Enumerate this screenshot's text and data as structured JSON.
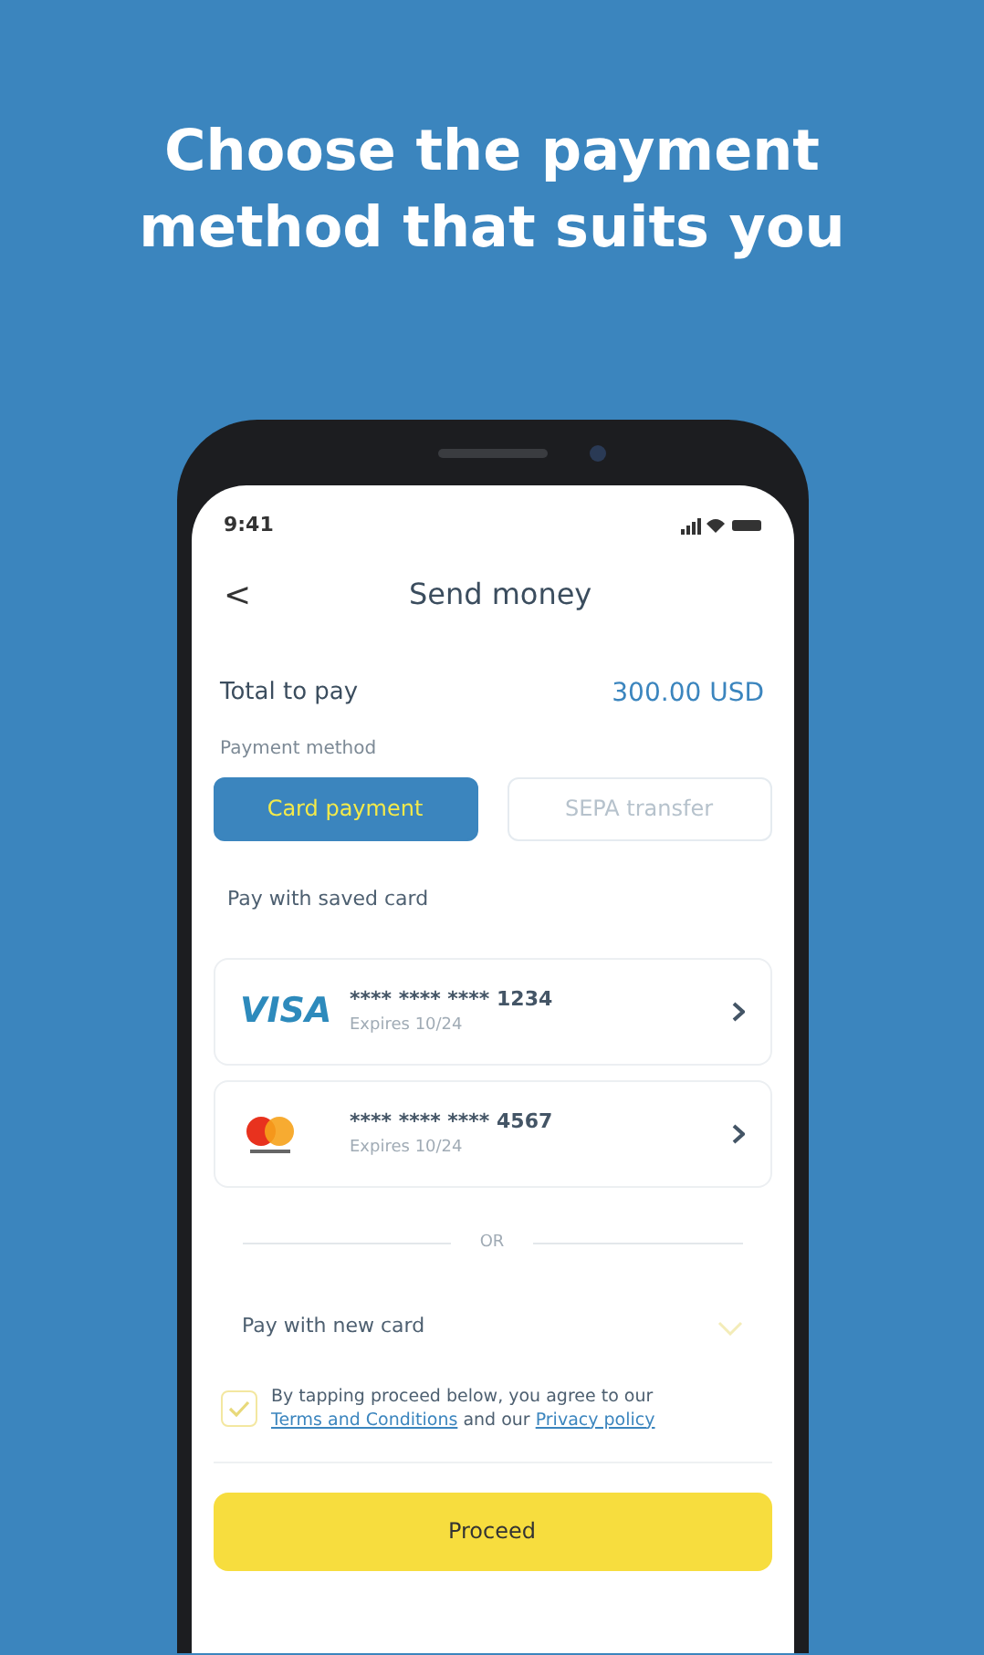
{
  "headline": "Choose the payment method that suits you",
  "status_bar": {
    "time": "9:41"
  },
  "header": {
    "back": "<",
    "title": "Send money"
  },
  "total": {
    "label": "Total to pay",
    "amount": "300.00 USD"
  },
  "payment_method": {
    "label": "Payment method",
    "tabs": [
      {
        "label": "Card payment",
        "selected": true
      },
      {
        "label": "SEPA transfer",
        "selected": false
      }
    ]
  },
  "saved_cards": {
    "label": "Pay with saved card",
    "cards": [
      {
        "kind": "visa",
        "logo": "VISA",
        "number": "**** **** **** 1234",
        "expires": "Expires 10/24"
      },
      {
        "kind": "mastercard",
        "number": "**** **** **** 4567",
        "expires": "Expires 10/24"
      }
    ]
  },
  "separator": "OR",
  "new_card": {
    "label": "Pay with new card",
    "expanded": false
  },
  "agreement": {
    "checked": true,
    "text": "By tapping proceed below, you agree to our",
    "terms_link": "Terms and Conditions",
    "middle": "and our",
    "privacy_link": "Privacy policy"
  },
  "proceed_button": "Proceed"
}
